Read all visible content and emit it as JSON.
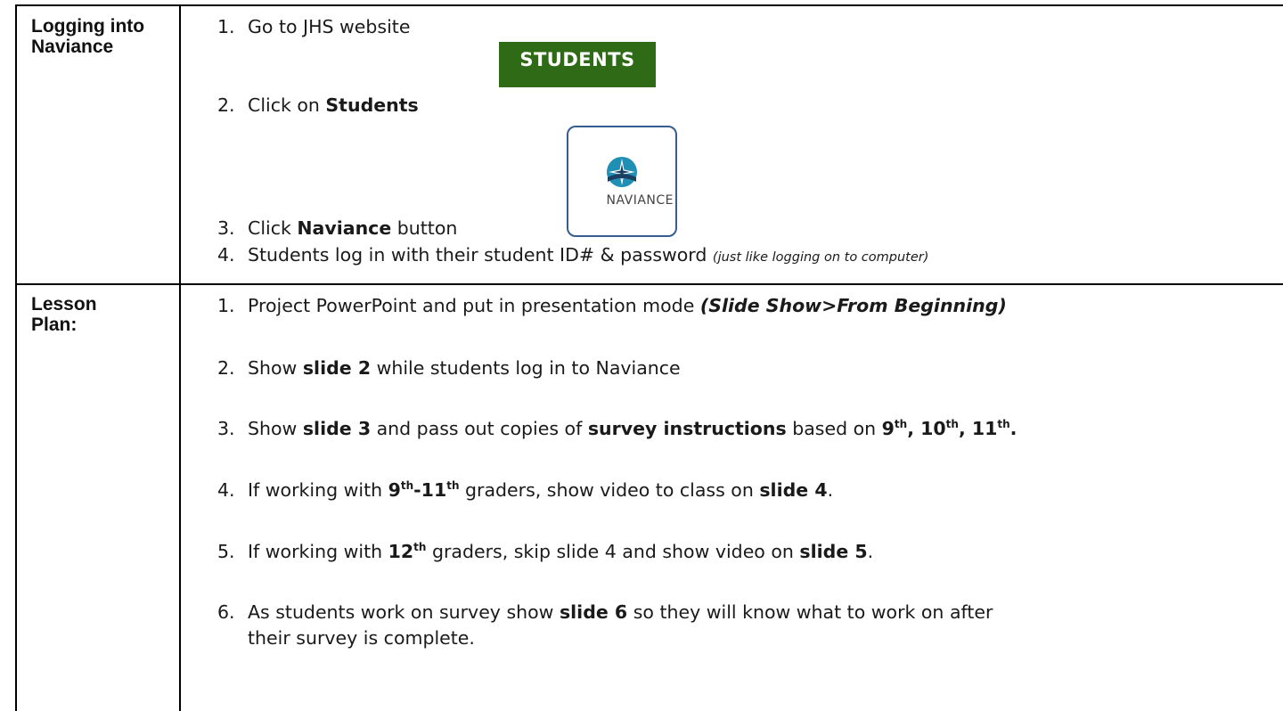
{
  "row1": {
    "label": "Logging into Naviance",
    "steps": [
      {
        "num": "1.",
        "text": "Go to JHS website"
      },
      {
        "num": "2.",
        "pre": "Click on ",
        "bold": "Students"
      },
      {
        "num": "3.",
        "pre": "Click ",
        "bold": "Naviance",
        "post": " button"
      },
      {
        "num": "4.",
        "pre": "Students log in with their student ID# & password ",
        "italic": "(just like logging on to computer)"
      }
    ],
    "students_button_label": "STUDENTS",
    "naviance_logo_text": "NAVIANCE"
  },
  "row2": {
    "label": "Lesson Plan:",
    "steps": [
      {
        "num": "1.",
        "pre": "Project PowerPoint and put in presentation mode ",
        "bold_italic": "(Slide Show>From Beginning)"
      },
      {
        "num": "2.",
        "pre": "Show ",
        "bold": "slide 2",
        "post": " while students log in to Naviance"
      },
      {
        "num": "3.",
        "pre": "Show ",
        "bold": "slide 3",
        "mid": " and pass out copies of ",
        "bold2": "survey instructions",
        "mid2": " based on ",
        "g1": "9",
        "g1s": "th",
        "g2": ", 10",
        "g2s": "th",
        "g3": ", 11",
        "g3s": "th",
        "g4": "."
      },
      {
        "num": "4.",
        "pre": "If working with ",
        "g1": "9",
        "g1s": "th",
        "g2": "-11",
        "g2s": "th",
        "mid": " graders, show video to class on ",
        "bold": "slide 4",
        "post": "."
      },
      {
        "num": "5.",
        "pre": "If working with ",
        "g1": "12",
        "g1s": "th",
        "mid": " graders, skip slide 4 and show video on ",
        "bold": "slide 5",
        "post": "."
      },
      {
        "num": "6.",
        "pre": "As students work on survey show ",
        "bold": "slide 6",
        "post": " so they will know what to work on after",
        "cont": "their survey is complete."
      }
    ]
  }
}
